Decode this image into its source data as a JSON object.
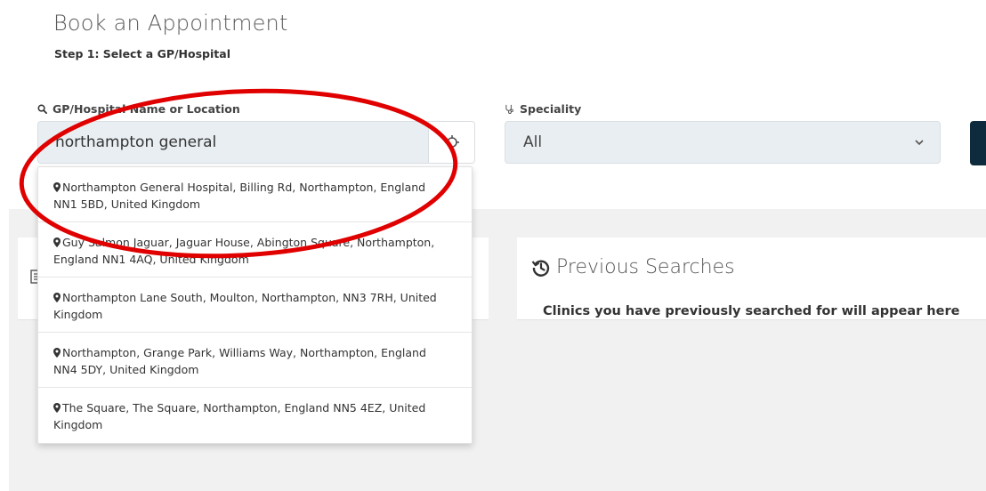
{
  "header": {
    "title": "Book an Appointment",
    "step": "Step 1: Select a GP/Hospital"
  },
  "search": {
    "label": "GP/Hospital Name or Location",
    "value": "northampton general",
    "placeholder": ""
  },
  "speciality": {
    "label": "Speciality",
    "selected": "All"
  },
  "suggestions": [
    {
      "text": "Northampton General Hospital, Billing Rd, Northampton, England NN1 5BD, United Kingdom"
    },
    {
      "text": "Guy Salmon Jaguar, Jaguar House, Abington Square, Northampton, England NN1 4AQ, United Kingdom"
    },
    {
      "text": "Northampton Lane South, Moulton, Northampton, NN3 7RH, United Kingdom"
    },
    {
      "text": "Northampton, Grange Park, Williams Way, Northampton, England NN4 5DY, United Kingdom"
    },
    {
      "text": "The Square, The Square, Northampton, England NN5 4EZ, United Kingdom"
    }
  ],
  "previous_searches": {
    "title": "Previous Searches",
    "description": "Clinics you have previously searched for will appear here"
  },
  "colors": {
    "annotation_ring": "#e00000",
    "search_button": "#0e2b3d",
    "input_background": "#e9eef2"
  },
  "icons": [
    "search-icon",
    "stethoscope-icon",
    "crosshair-icon",
    "chevron-down-icon",
    "map-pin-icon",
    "history-icon",
    "document-icon"
  ]
}
